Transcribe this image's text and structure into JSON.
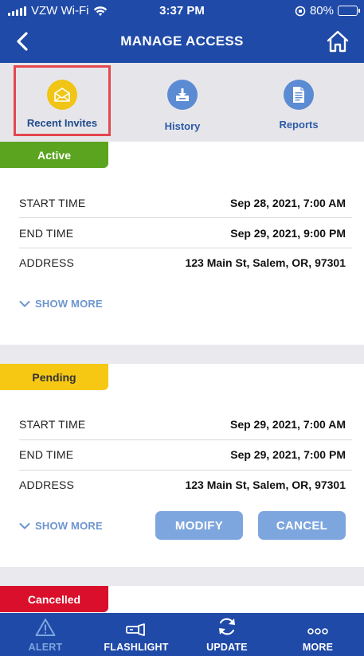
{
  "status_bar": {
    "carrier": "VZW Wi-Fi",
    "time": "3:37 PM",
    "battery": "80%"
  },
  "header": {
    "title": "MANAGE ACCESS"
  },
  "tabs": [
    {
      "label": "Recent Invites",
      "icon": "envelope-icon",
      "selected": true
    },
    {
      "label": "History",
      "icon": "download-tray-icon"
    },
    {
      "label": "Reports",
      "icon": "document-icon"
    }
  ],
  "colors": {
    "primary": "#1f4aa8",
    "active": "#5ba41f",
    "pending": "#f6c814",
    "cancelled": "#d90f2b",
    "button": "#7ea6de",
    "highlight": "#e4474e"
  },
  "invites": [
    {
      "status": "Active",
      "rows": [
        {
          "key": "START TIME",
          "value": "Sep 28, 2021, 7:00 AM"
        },
        {
          "key": "END TIME",
          "value": "Sep 29, 2021, 9:00 PM"
        },
        {
          "key": "ADDRESS",
          "value": "123 Main St, Salem, OR, 97301"
        }
      ],
      "show_more": "SHOW MORE"
    },
    {
      "status": "Pending",
      "rows": [
        {
          "key": "START TIME",
          "value": "Sep 29, 2021, 7:00 AM"
        },
        {
          "key": "END TIME",
          "value": "Sep 29, 2021, 7:00 PM"
        },
        {
          "key": "ADDRESS",
          "value": "123 Main St, Salem, OR, 97301"
        }
      ],
      "show_more": "SHOW MORE",
      "modify_label": "MODIFY",
      "cancel_label": "CANCEL"
    },
    {
      "status": "Cancelled"
    }
  ],
  "bottom_nav": [
    {
      "label": "ALERT",
      "icon": "warning-triangle-icon"
    },
    {
      "label": "FLASHLIGHT",
      "icon": "flashlight-icon"
    },
    {
      "label": "UPDATE",
      "icon": "refresh-icon"
    },
    {
      "label": "MORE",
      "icon": "more-dots-icon"
    }
  ]
}
